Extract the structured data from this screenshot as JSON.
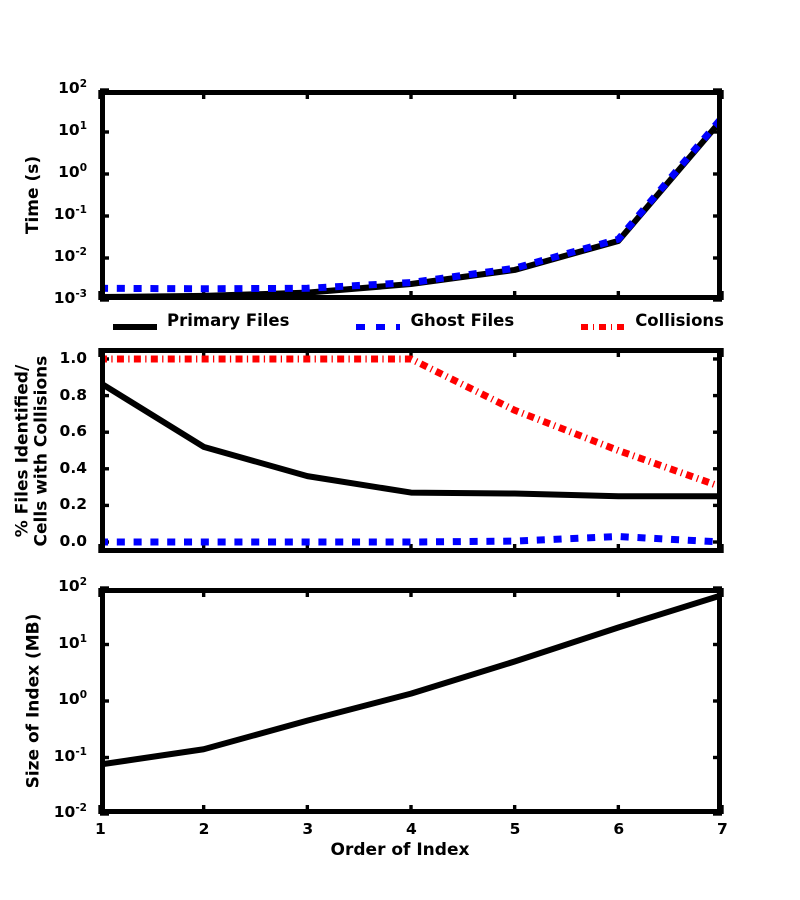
{
  "figure": {
    "xlabel": "Order of Index",
    "x_tick_labels": [
      "1",
      "2",
      "3",
      "4",
      "5",
      "6",
      "7"
    ],
    "colors": {
      "primary": "#000000",
      "ghost": "#0000FF",
      "collisions": "#FF0000",
      "background": "#FFFFFF"
    }
  },
  "legend": {
    "position": "between-panel-1-and-2",
    "entries": [
      {
        "label": "Primary Files",
        "color": "#000000",
        "style": "solid"
      },
      {
        "label": "Ghost Files",
        "color": "#0000FF",
        "style": "dashed"
      },
      {
        "label": "Collisions",
        "color": "#FF0000",
        "style": "dashdot"
      }
    ]
  },
  "panel1": {
    "ylabel": "Time (s)",
    "y_tick_labels": [
      "10²",
      "10¹",
      "10⁰",
      "10⁻¹",
      "10⁻²",
      "10⁻³"
    ],
    "y_tick_mantissas": [
      "10",
      "10",
      "10",
      "10",
      "10",
      "10"
    ],
    "y_tick_exponents": [
      "2",
      "1",
      "0",
      "-1",
      "-2",
      "-3"
    ]
  },
  "panel2": {
    "ylabel_line1": "% Files Identified/",
    "ylabel_line2": "Cells with Collisions",
    "y_tick_labels": [
      "1.0",
      "0.8",
      "0.6",
      "0.4",
      "0.2",
      "0.0"
    ]
  },
  "panel3": {
    "ylabel": "Size of Index (MB)",
    "y_tick_labels": [
      "10²",
      "10¹",
      "10⁰",
      "10⁻¹",
      "10⁻²"
    ],
    "y_tick_mantissas": [
      "10",
      "10",
      "10",
      "10",
      "10"
    ],
    "y_tick_exponents": [
      "2",
      "1",
      "0",
      "-1",
      "-2"
    ]
  },
  "chart_data": [
    {
      "type": "line",
      "panel": 1,
      "title": "",
      "xlabel": "",
      "ylabel": "Time (s)",
      "yscale": "log",
      "xlim": [
        1,
        7
      ],
      "ylim": [
        0.001,
        100
      ],
      "grid": false,
      "legend_position": "below-axes",
      "x": [
        1,
        2,
        3,
        4,
        5,
        6,
        7
      ],
      "series": [
        {
          "name": "Primary Files",
          "color": "#000000",
          "style": "solid",
          "values": [
            0.00118,
            0.00125,
            0.0015,
            0.0024,
            0.0052,
            0.0255,
            20.0
          ]
        },
        {
          "name": "Ghost Files",
          "color": "#0000FF",
          "style": "dashed",
          "values": [
            0.0019,
            0.00185,
            0.0019,
            0.0026,
            0.0057,
            0.028,
            22.0
          ]
        }
      ]
    },
    {
      "type": "line",
      "panel": 2,
      "title": "",
      "xlabel": "",
      "ylabel": "% Files Identified/Cells with Collisions",
      "yscale": "linear",
      "xlim": [
        1,
        7
      ],
      "ylim": [
        -0.06,
        1.06
      ],
      "grid": false,
      "x": [
        1,
        2,
        3,
        4,
        5,
        6,
        7
      ],
      "series": [
        {
          "name": "Primary Files",
          "color": "#000000",
          "style": "solid",
          "values": [
            0.87,
            0.52,
            0.36,
            0.27,
            0.265,
            0.25,
            0.25
          ]
        },
        {
          "name": "Ghost Files",
          "color": "#0000FF",
          "style": "dashed",
          "values": [
            0.0,
            0.0,
            0.0,
            0.0,
            0.005,
            0.03,
            0.0
          ]
        },
        {
          "name": "Collisions",
          "color": "#FF0000",
          "style": "dashdot",
          "values": [
            1.0,
            1.0,
            1.0,
            1.0,
            0.72,
            0.5,
            0.3
          ]
        }
      ]
    },
    {
      "type": "line",
      "panel": 3,
      "title": "",
      "xlabel": "Order of Index",
      "ylabel": "Size of Index (MB)",
      "yscale": "log",
      "xlim": [
        1,
        7
      ],
      "ylim": [
        0.01,
        100
      ],
      "grid": false,
      "x": [
        1,
        2,
        3,
        4,
        5,
        6,
        7
      ],
      "series": [
        {
          "name": "Size of Index",
          "color": "#000000",
          "style": "solid",
          "values": [
            0.075,
            0.14,
            0.45,
            1.35,
            5.0,
            20.0,
            75.0
          ]
        }
      ]
    }
  ]
}
